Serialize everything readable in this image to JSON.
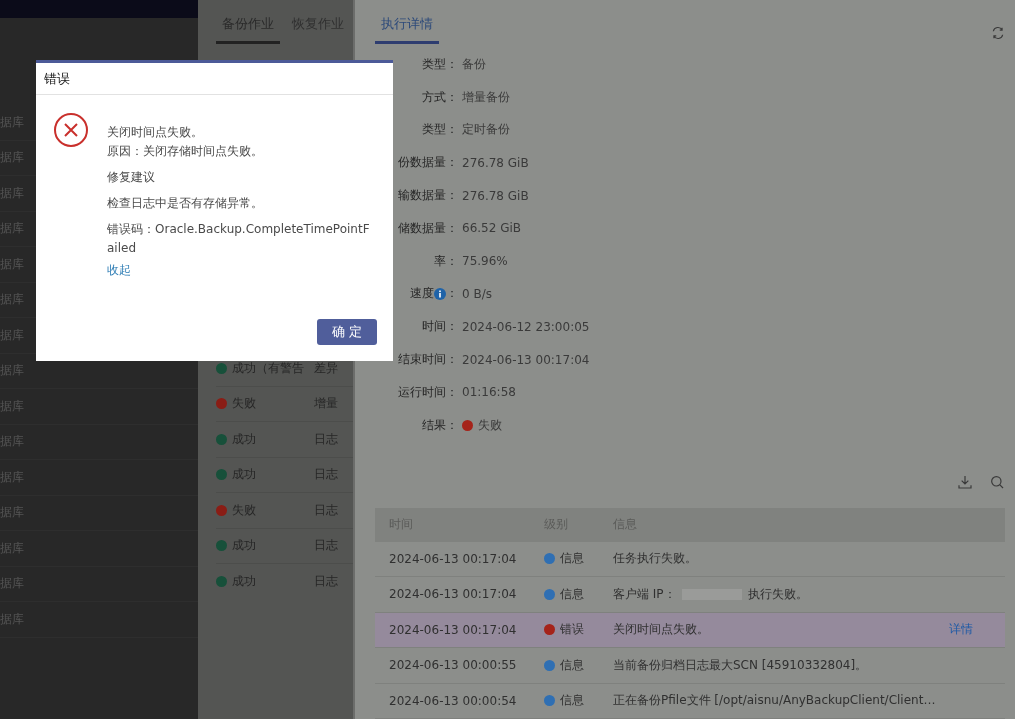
{
  "left_list": {
    "items": [
      "据库",
      "据库",
      "据库",
      "据库",
      "据库",
      "据库",
      "据库",
      "据库",
      "据库",
      "据库",
      "据库",
      "据库",
      "据库",
      "据库",
      "据库"
    ]
  },
  "jobs_panel": {
    "tabs": [
      {
        "label": "备份作业",
        "selected": true
      },
      {
        "label": "恢复作业",
        "selected": false
      }
    ],
    "rows": [
      {
        "color": "#17503a",
        "status_text": "成功（有警告",
        "type": "差异"
      },
      {
        "color": "#8a1d15",
        "status_text": "失败",
        "type": "增量"
      },
      {
        "color": "#17503a",
        "status_text": "成功",
        "type": "日志"
      },
      {
        "color": "#17503a",
        "status_text": "成功",
        "type": "日志"
      },
      {
        "color": "#8a1d15",
        "status_text": "失败",
        "type": "日志"
      },
      {
        "color": "#17503a",
        "status_text": "成功",
        "type": "日志"
      },
      {
        "color": "#17503a",
        "status_text": "成功",
        "type": "日志"
      }
    ]
  },
  "detail_panel": {
    "tabs": [
      {
        "label": "执行详情",
        "selected": true
      }
    ],
    "fields": [
      {
        "label": "类型：",
        "value": "备份"
      },
      {
        "label": "方式：",
        "value": "增量备份"
      },
      {
        "label": "类型：",
        "value": "定时备份"
      },
      {
        "label": "份数据量：",
        "value": "276.78 GiB"
      },
      {
        "label": "输数据量：",
        "value": "276.78 GiB"
      },
      {
        "label": "储数据量：",
        "value": "66.52 GiB"
      },
      {
        "label": "率：",
        "value": "75.96%"
      },
      {
        "label": "速度",
        "info_icon": true,
        "label_suffix": "：",
        "value": "0 B/s"
      },
      {
        "label": "时间：",
        "value": "2024-06-12 23:00:05"
      },
      {
        "label": "结束时间：",
        "value": "2024-06-13 00:17:04"
      },
      {
        "label": "运行时间：",
        "value": "01:16:58"
      },
      {
        "label": "结果：",
        "value": "失败",
        "color": "#a5231a"
      }
    ],
    "log_table": {
      "columns": [
        "时间",
        "级别",
        "信息"
      ],
      "rows": [
        {
          "time": "2024-06-13 00:17:04",
          "color": "#2f6fb3",
          "level_text": "信息",
          "message": "任务执行失败。",
          "selected": false
        },
        {
          "time": "2024-06-13 00:17:04",
          "color": "#2f6fb3",
          "level_text": "信息",
          "message": "客户端 IP：",
          "redacted": true,
          "message_after": "执行失败。",
          "selected": false
        },
        {
          "time": "2024-06-13 00:17:04",
          "color": "#a5231a",
          "level_text": "错误",
          "message": "关闭时间点失败。",
          "action": "详情",
          "selected": true
        },
        {
          "time": "2024-06-13 00:00:55",
          "color": "#2f6fb3",
          "level_text": "信息",
          "message": "当前备份归档日志最大SCN [45910332804]。",
          "selected": false
        },
        {
          "time": "2024-06-13 00:00:54",
          "color": "#2f6fb3",
          "level_text": "信息",
          "message": "正在备份Pfile文件 [/opt/aisnu/AnyBackupClient/Client…",
          "selected": false
        }
      ]
    }
  },
  "dialog": {
    "title": "错误",
    "lines": [
      "关闭时间点失败。",
      "原因：关闭存储时间点失败。"
    ],
    "suggestion_title": "修复建议",
    "suggestion": "检查日志中是否有存储异常。",
    "error_code": "错误码：Oracle.Backup.CompleteTimePointFailed",
    "collapse_link": "收起",
    "ok_button": "确 定"
  }
}
